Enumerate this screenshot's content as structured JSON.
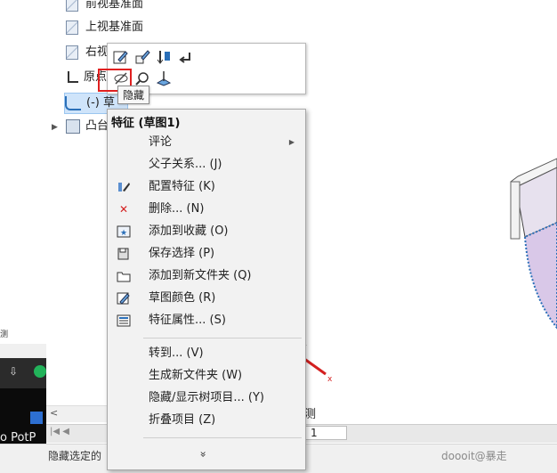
{
  "tree": {
    "items": [
      {
        "label": "前视基准面"
      },
      {
        "label": "上视基准面"
      },
      {
        "label": "右视"
      },
      {
        "label": "原点"
      },
      {
        "label": "(-) 草"
      },
      {
        "label": "凸台"
      }
    ]
  },
  "toolbar": {
    "tooltip": "隐藏"
  },
  "menu": {
    "title": "特征 (草图1)",
    "items": [
      {
        "label": "评论",
        "has_submenu": true
      },
      {
        "label": "父子关系... (J)"
      },
      {
        "label": "配置特征 (K)"
      },
      {
        "label": "删除... (N)"
      },
      {
        "label": "添加到收藏 (O)"
      },
      {
        "label": "保存选择 (P)"
      },
      {
        "label": "添加到新文件夹 (Q)"
      },
      {
        "label": "草图颜色 (R)"
      },
      {
        "label": "特征属性... (S)"
      },
      {
        "label": "转到... (V)"
      },
      {
        "label": "生成新文件夹 (W)"
      },
      {
        "label": "隐藏/显示树项目... (Y)"
      },
      {
        "label": "折叠项目 (Z)"
      }
    ],
    "expand_glyph": "»"
  },
  "bottom": {
    "status_text": "隐藏选定的",
    "page_number": "1",
    "taskbar_text": "o PotP",
    "left_label": "测",
    "view_label": "测"
  },
  "watermark": "doooit@暴走",
  "colors": {
    "highlight_red": "#e02020",
    "selection_blue": "#cfe4fa",
    "delete_red": "#d42020"
  }
}
